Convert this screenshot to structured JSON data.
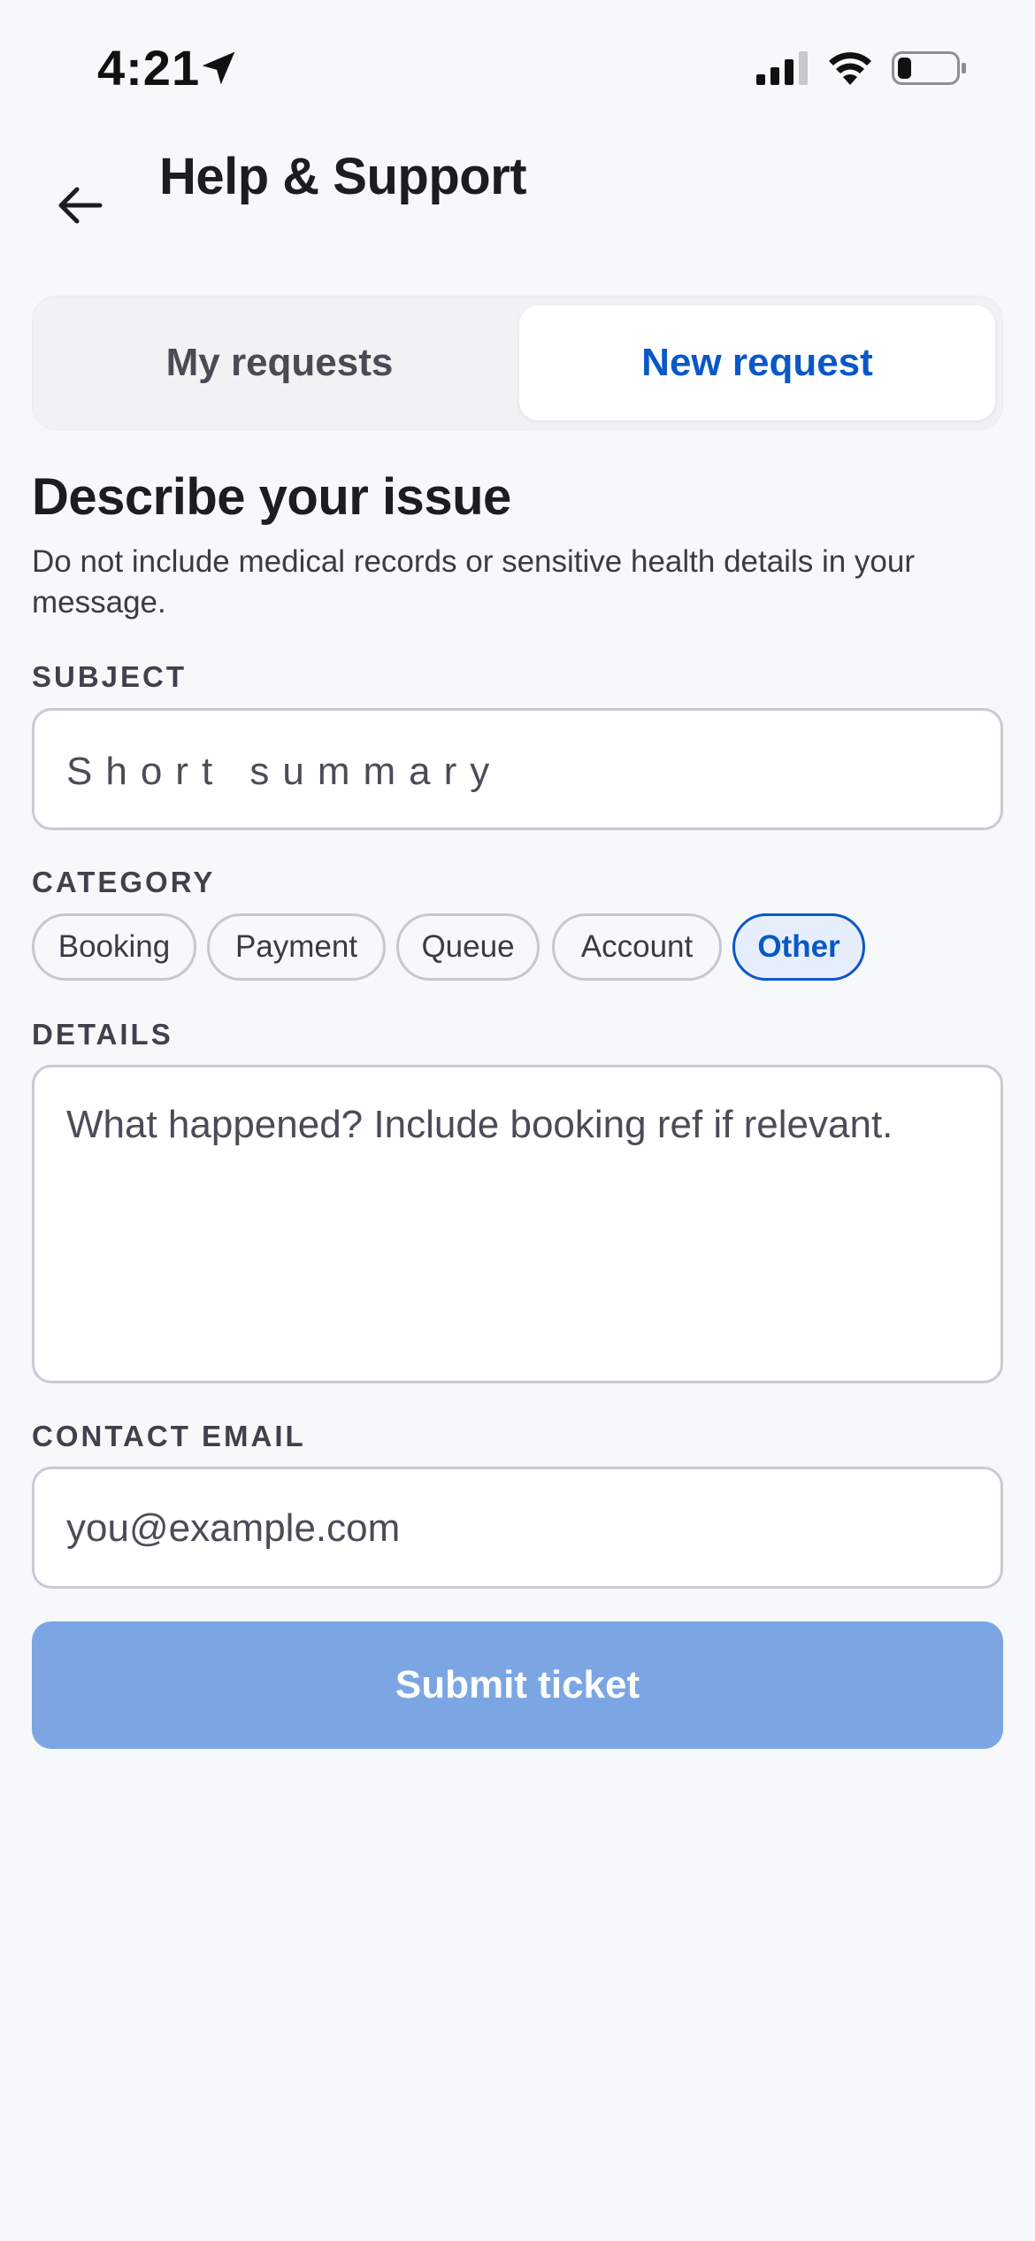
{
  "status_bar": {
    "time": "4:21",
    "icons": [
      "location-arrow-icon",
      "cellular-signal-icon",
      "wifi-icon",
      "battery-icon"
    ]
  },
  "header": {
    "back_icon": "arrow-left-icon",
    "title": "Help & Support"
  },
  "tabs": [
    {
      "label": "My requests",
      "active": false
    },
    {
      "label": "New request",
      "active": true
    }
  ],
  "form": {
    "title": "Describe your issue",
    "note": "Do not include medical records or sensitive health details in your message.",
    "subject": {
      "label": "SUBJECT",
      "value": "",
      "placeholder": "Short summary"
    },
    "category": {
      "label": "CATEGORY",
      "options": [
        "Booking",
        "Payment",
        "Queue",
        "Account",
        "Other"
      ],
      "selected": "Other"
    },
    "details": {
      "label": "DETAILS",
      "value": "",
      "placeholder": "What happened? Include booking ref if relevant."
    },
    "email": {
      "label": "CONTACT EMAIL",
      "value": "",
      "placeholder": "you@example.com"
    },
    "submit_label": "Submit ticket"
  },
  "colors": {
    "accent": "#0b57c8",
    "background": "#f7f8fa",
    "submit_disabled": "#7ba6e3",
    "chip_selected_bg": "#e7eefb"
  }
}
